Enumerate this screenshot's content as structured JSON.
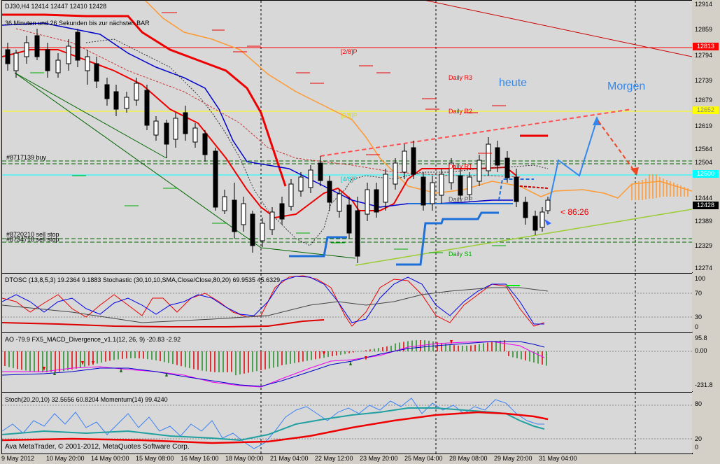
{
  "header": {
    "symbol_line": "DJ30,H4  12414 12447 12410 12428",
    "countdown": "36 Minuten und 26 Sekunden bis zur nächsten BAR"
  },
  "main_labels": {
    "pivot_28": "[2/8]P",
    "pivot_48": "[4/8]P",
    "pivot_38": "[3/8]P",
    "daily_r3": "Daily R3",
    "daily_r2": "Daily R2",
    "daily_r1": "Daily R1",
    "daily_pp": "Daily PP",
    "daily_s1": "Daily S1",
    "buy_order": "#8717139 buy",
    "sell_stop_1": "#8720210 sell stop",
    "sell_stop_2": "#8734718 sell stop",
    "heute": "heute",
    "morgen": "Morgen",
    "countdown_marker": "< 86:26"
  },
  "price_axis": {
    "ticks": [
      "12914",
      "12859",
      "12794",
      "12739",
      "12679",
      "12619",
      "12564",
      "12504",
      "12444",
      "12389",
      "12329",
      "12274"
    ],
    "tag_12813": "12813",
    "tag_12652": "12652",
    "tag_12500": "12500",
    "tag_12428": "12428"
  },
  "colors": {
    "tag_red": "#ff0000",
    "tag_yellow": "#ffff00",
    "tag_cyan": "#00ffff",
    "tag_black": "#000000"
  },
  "osc1": {
    "label": "DTOSC (13,8,5,3) 19.2364 9.1883  Stochastic (30,10,10,SMA,Close/Close,80,20) 69.9535 45.6329",
    "ticks": [
      "100",
      "70",
      "30",
      "0"
    ]
  },
  "osc2": {
    "label": "AO -79.9  FX5_MACD_Divergence_v1.1(12, 26, 9) -20.83 -2.92",
    "ticks": [
      "95.8",
      "0.00",
      "-231.8"
    ]
  },
  "osc3": {
    "label": "Stoch(20,20,10) 32.5656 60.8204  Momentum(14) 99.4240",
    "ticks": [
      "80",
      "20",
      "0"
    ],
    "copyright": "Ava MetaTrader, © 2001-2012, MetaQuotes Software Corp."
  },
  "time_axis": [
    "9 May 2012",
    "10 May 20:00",
    "14 May 00:00",
    "15 May 08:00",
    "16 May 16:00",
    "18 May 00:00",
    "21 May 04:00",
    "22 May 12:00",
    "23 May 20:00",
    "25 May 04:00",
    "28 May 08:00",
    "29 May 20:00",
    "31 May 04:00"
  ]
}
